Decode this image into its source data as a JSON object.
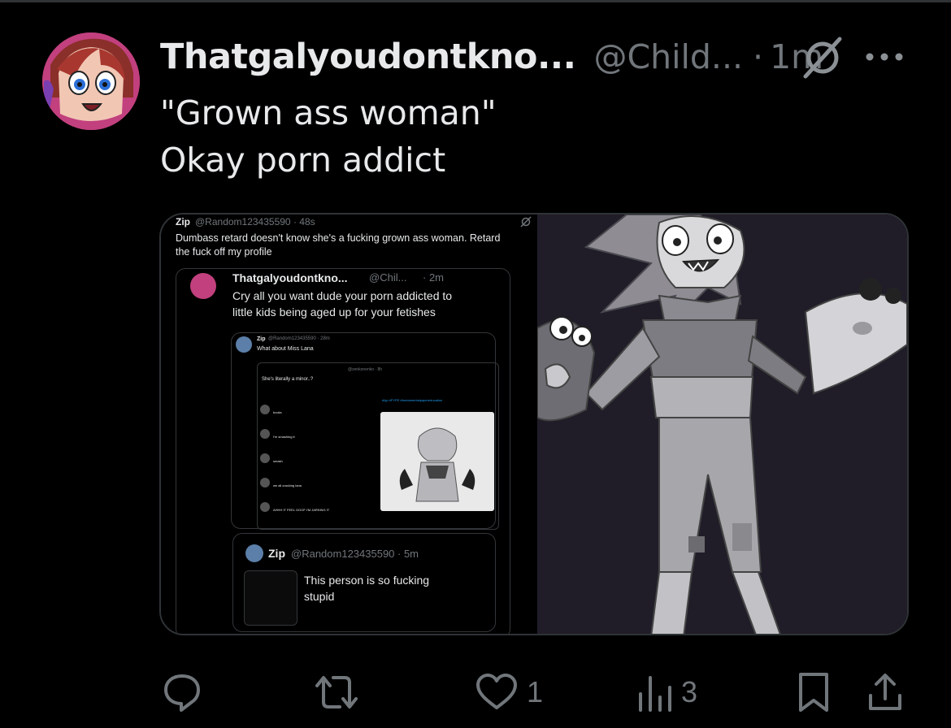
{
  "post": {
    "display_name": "Thatgalyoudontkno...",
    "handle": "@Child...",
    "separator": "·",
    "time": "1m",
    "text_line1": "\"Grown ass woman\"",
    "text_line2": "Okay porn addict"
  },
  "media": {
    "screenshot": {
      "outer_author": "Zip",
      "outer_handle": "@Random123435590 · 48s",
      "outer_text1": "Dumbass retard doesn't know she's a fucking grown ass woman. Retard",
      "outer_text2": "the fuck off my profile",
      "quote1_author": "Thatgalyoudontkno...",
      "quote1_handle": "@Chil...",
      "quote1_time": "· 2m",
      "quote1_text1": "Cry all you want dude your porn addicted to",
      "quote1_text2": "little kids being aged up for your fetishes",
      "quote2_author": "Zip",
      "quote2_handle": "@Random123435590 · 28m",
      "quote2_text": "What about Miss Lana",
      "quote3_handle": "@zenkonenko · 8h",
      "quote3_text": "She's literally a minor..?",
      "hashtag_line": "#fyp #FYPE #fundamentalpapereducation",
      "reply_texts": [
        "books",
        "I'm smashing it",
        "smash",
        "we all cracking lana",
        "AHHH IT FEEL GOOF I'M JARKING IT"
      ],
      "quote4_author": "Zip",
      "quote4_handle": "@Random123435590 · 5m",
      "quote4_text1": "This person is so fucking",
      "quote4_text2": "stupid"
    }
  },
  "actions": {
    "reply_count": "",
    "repost_count": "",
    "like_count": "1",
    "views_count": "3"
  },
  "colors": {
    "background": "#000000",
    "text": "#e7e9ea",
    "muted": "#71767b",
    "border": "#2f3336"
  }
}
